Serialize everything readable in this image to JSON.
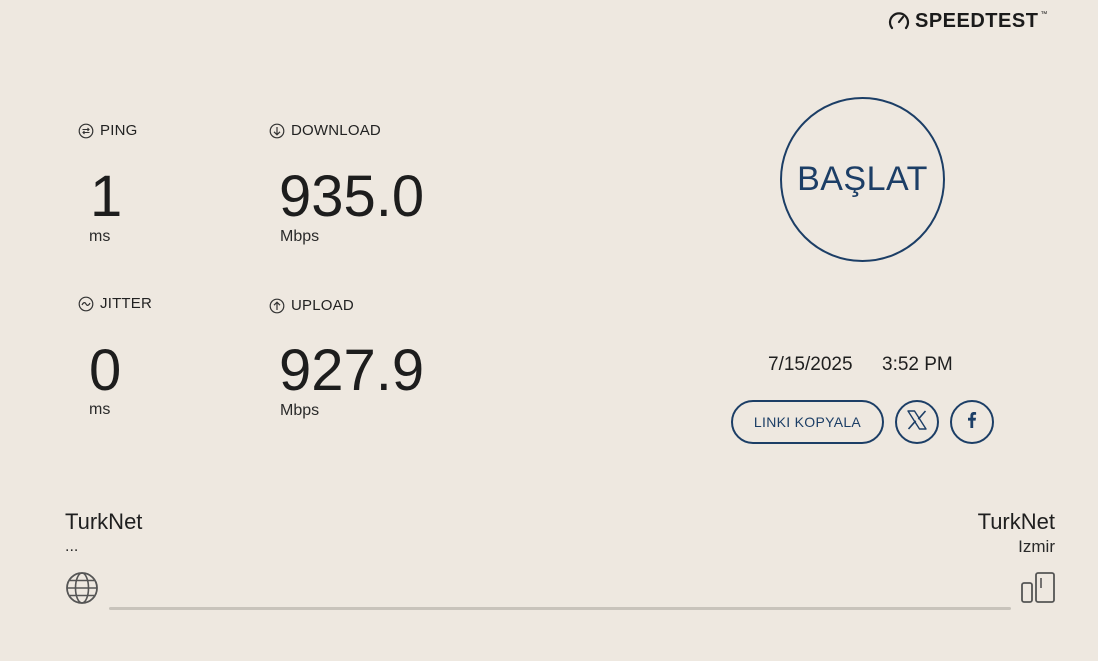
{
  "brand": {
    "name": "SPEEDTEST",
    "trademark": "™"
  },
  "metrics": {
    "ping": {
      "label": "PING",
      "value": "1",
      "unit": "ms"
    },
    "download": {
      "label": "DOWNLOAD",
      "value": "935.0",
      "unit": "Mbps"
    },
    "jitter": {
      "label": "JITTER",
      "value": "0",
      "unit": "ms"
    },
    "upload": {
      "label": "UPLOAD",
      "value": "927.9",
      "unit": "Mbps"
    }
  },
  "start_button": {
    "label": "BAŞLAT"
  },
  "result": {
    "date": "7/15/2025",
    "time": "3:52 PM",
    "copy_link_label": "LINKI KOPYALA"
  },
  "isp": {
    "name": "TurkNet",
    "ip": "..."
  },
  "server": {
    "name": "TurkNet",
    "location": "Izmir"
  },
  "icons": {
    "logo": "speedometer-icon",
    "ping": "ping-icon",
    "download": "download-arrow-icon",
    "jitter": "jitter-wave-icon",
    "upload": "upload-arrow-icon",
    "share_x": "x-icon",
    "share_facebook": "facebook-icon",
    "isp": "globe-icon",
    "server": "server-icon"
  },
  "colors": {
    "accent": "#1c3e66",
    "background": "#eee8e0",
    "text": "#1f1f1f"
  }
}
